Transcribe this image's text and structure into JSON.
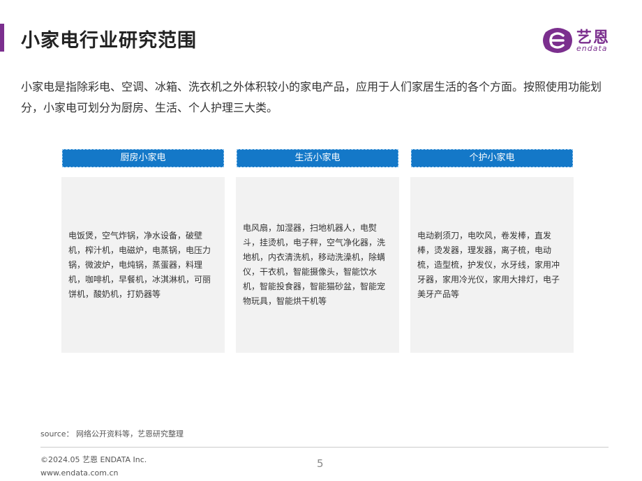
{
  "header": {
    "title": "小家电行业研究范围",
    "logo_cn": "艺恩",
    "logo_en": "endata"
  },
  "intro": "小家电是指除彩电、空调、冰箱、洗衣机之外体积较小的家电产品，应用于人们家居生活的各个方面。按照使用功能划分，小家电可划分为厨房、生活、个人护理三大类。",
  "columns": [
    {
      "title": "厨房小家电",
      "items": "电饭煲，空气炸锅，净水设备，破壁机，榨汁机，电磁炉，电蒸锅，电压力锅，微波炉，电炖锅，蒸蛋器，料理机，咖啡机，早餐机，冰淇淋机，可丽饼机，酸奶机，打奶器等"
    },
    {
      "title": "生活小家电",
      "items": "电风扇，加湿器，扫地机器人，电熨斗，挂烫机，电子秤，空气净化器，洗地机，内衣清洗机，移动洗澡机，除螨仪，干衣机，智能摄像头，智能饮水机，智能投食器，智能猫砂盆，智能宠物玩具，智能烘干机等"
    },
    {
      "title": "个护小家电",
      "items": "电动剃须刀，电吹风，卷发棒，直发棒，烫发器，理发器，离子梳，电动梳，造型梳，护发仪，水牙线，家用冲牙器，家用冷光仪，家用大排灯，电子美牙产品等"
    }
  ],
  "footer": {
    "source": "source： 网络公开资料等，艺恩研究整理",
    "copyright": "©2024.05  艺恩 ENDATA Inc.",
    "website": "www.endata.com.cn",
    "page_number": "5"
  },
  "colors": {
    "accent": "#7b2f8e",
    "header_blue": "#1478c8",
    "box_gray": "#f2f2f2"
  }
}
